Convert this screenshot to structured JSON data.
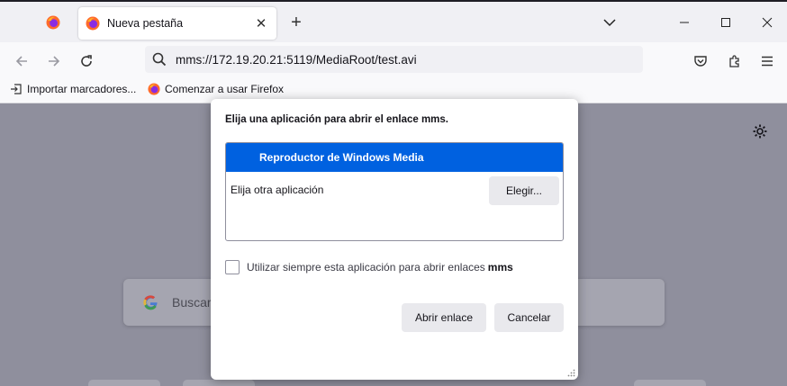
{
  "browser": {
    "tab": {
      "title": "Nueva pestaña"
    },
    "url": "mms://172.19.20.21:5119/MediaRoot/test.avi",
    "bookmarks": [
      {
        "label": "Importar marcadores...",
        "icon": "import-icon"
      },
      {
        "label": "Comenzar a usar Firefox",
        "icon": "firefox-icon"
      }
    ]
  },
  "newtab": {
    "search_placeholder": "Buscar"
  },
  "dialog": {
    "title": "Elija una aplicación para abrir el enlace mms.",
    "selected_app": "Reproductor de Windows Media",
    "other_app_label": "Elija otra aplicación",
    "choose_button": "Elegir...",
    "checkbox": {
      "label_prefix": "Utilizar siempre esta aplicación para abrir enlaces",
      "label_bold": "mms",
      "checked": false
    },
    "open_button": "Abrir enlace",
    "cancel_button": "Cancelar"
  },
  "colors": {
    "accent": "#0061e0",
    "overlay": "#8f8f9d"
  }
}
